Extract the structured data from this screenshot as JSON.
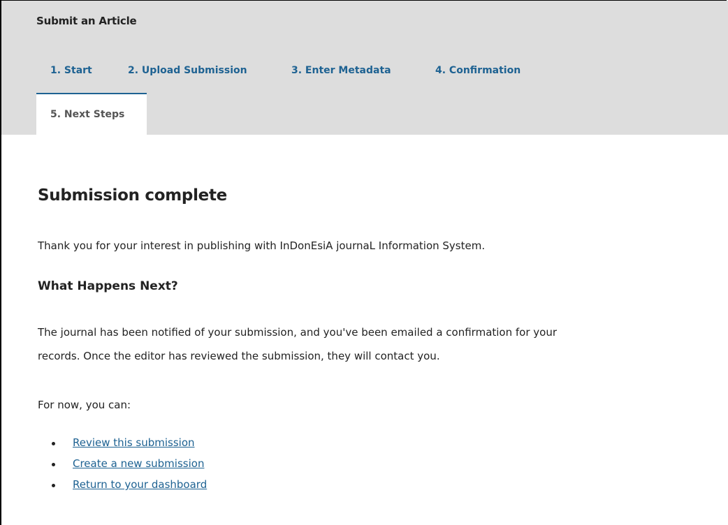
{
  "header": {
    "title": "Submit an Article",
    "tabs": [
      {
        "label": "1. Start"
      },
      {
        "label": "2. Upload Submission"
      },
      {
        "label": "3. Enter Metadata"
      },
      {
        "label": "4. Confirmation"
      },
      {
        "label": "5. Next Steps"
      }
    ],
    "active_tab": "5. Next Steps"
  },
  "content": {
    "title": "Submission complete",
    "thanks": "Thank you for your interest in publishing with InDonEsiA journaL Information System.",
    "subheading": "What Happens Next?",
    "next_line1": "The journal has been notified of your submission, and you've been emailed a confirmation for your",
    "next_line2": "records. Once the editor has reviewed the submission, they will contact you.",
    "for_now": "For now, you can:",
    "links": [
      {
        "label": "Review this submission"
      },
      {
        "label": "Create a new submission"
      },
      {
        "label": "Return to your dashboard"
      }
    ]
  },
  "colors": {
    "header_bg": "#dddddd",
    "link": "#1e6292",
    "active_tab_text": "#555555"
  }
}
